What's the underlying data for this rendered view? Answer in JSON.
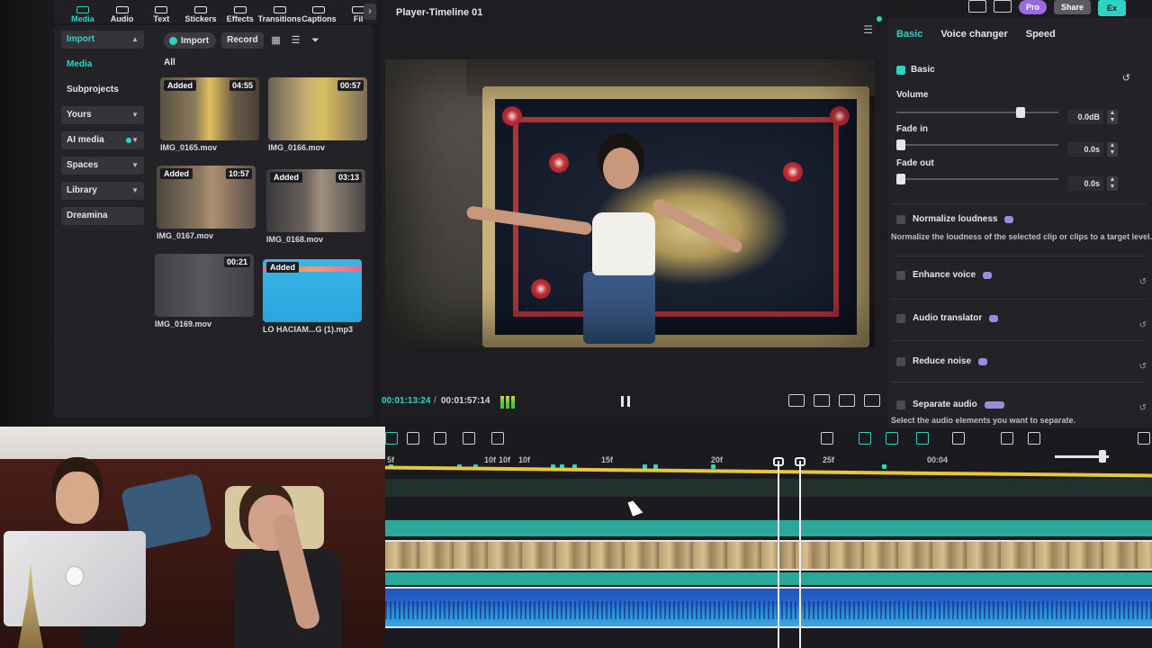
{
  "toolbar": {
    "tabs": [
      {
        "label": "Media",
        "icon": "media-icon"
      },
      {
        "label": "Audio",
        "icon": "music-icon"
      },
      {
        "label": "Text",
        "icon": "text-icon"
      },
      {
        "label": "Stickers",
        "icon": "sticker-icon"
      },
      {
        "label": "Effects",
        "icon": "effects-icon"
      },
      {
        "label": "Transitions",
        "icon": "transition-icon"
      },
      {
        "label": "Captions",
        "icon": "caption-icon"
      },
      {
        "label": "Fil",
        "icon": "filter-icon"
      }
    ],
    "active_tab": "Media"
  },
  "sidebar": {
    "items": [
      {
        "label": "Import",
        "style": "import"
      },
      {
        "label": "Media",
        "style": "selected"
      },
      {
        "label": "Subprojects",
        "style": "plain"
      },
      {
        "label": "Yours",
        "style": "box"
      },
      {
        "label": "AI media",
        "style": "box"
      },
      {
        "label": "Spaces",
        "style": "box"
      },
      {
        "label": "Library",
        "style": "box"
      },
      {
        "label": "Dreamina",
        "style": "box"
      }
    ]
  },
  "media": {
    "import_label": "Import",
    "record_label": "Record",
    "filter_label": "All",
    "items": [
      {
        "name": "IMG_0165.mov",
        "tag": "Added",
        "duration": "04:55"
      },
      {
        "name": "IMG_0166.mov",
        "tag": "",
        "duration": "00:57"
      },
      {
        "name": "IMG_0167.mov",
        "tag": "Added",
        "duration": "10:57"
      },
      {
        "name": "IMG_0168.mov",
        "tag": "Added",
        "duration": "03:13"
      },
      {
        "name": "IMG_0169.mov",
        "tag": "",
        "duration": "00:21"
      },
      {
        "name": "LO HACIAM...G (1).mp3",
        "tag": "Added",
        "duration": ""
      }
    ]
  },
  "player": {
    "title": "Player-Timeline 01",
    "current_time": "00:01:13:24",
    "separator": "/",
    "total_time": "00:01:57:14"
  },
  "header_right": {
    "pro_label": "Pro",
    "share_label": "Share",
    "export_label": "Ex"
  },
  "properties": {
    "tabs": [
      "Basic",
      "Voice changer",
      "Speed"
    ],
    "active_tab": "Basic",
    "section_title": "Basic",
    "volume": {
      "label": "Volume",
      "value": "0.0dB",
      "level": 0.78
    },
    "fade_in": {
      "label": "Fade in",
      "value": "0.0s",
      "level": 0.0
    },
    "fade_out": {
      "label": "Fade out",
      "value": "0.0s",
      "level": 0.0
    },
    "normalize": {
      "label": "Normalize loudness",
      "desc": "Normalize the loudness of the selected clip or clips to a target level."
    },
    "enhance": {
      "label": "Enhance voice"
    },
    "translator": {
      "label": "Audio translator"
    },
    "reduce_noise": {
      "label": "Reduce noise"
    },
    "separate": {
      "label": "Separate audio",
      "desc": "Select the audio elements you want to separate."
    }
  },
  "timeline": {
    "ruler_labels": [
      "5f",
      "10f",
      "10f",
      "10f",
      "15f",
      "20f",
      "25f",
      "00:04"
    ],
    "zoom_level": 0.88
  },
  "colors": {
    "accent": "#2fd3c5",
    "timeline_yellow": "#e8c83a",
    "audio_blue": "#2a66d0"
  }
}
